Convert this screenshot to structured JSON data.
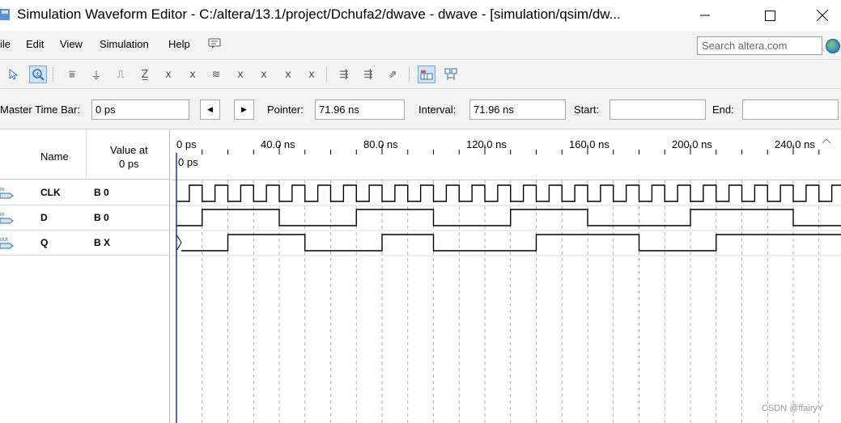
{
  "window": {
    "title": "Simulation Waveform Editor - C:/altera/13.1/project/Dchufa2/dwave - dwave - [simulation/qsim/dw...",
    "min_icon": "minimize-icon",
    "max_icon": "maximize-icon",
    "close_icon": "close-icon"
  },
  "menu": {
    "items": [
      "ile",
      "Edit",
      "View",
      "Simulation",
      "Help"
    ],
    "search_placeholder": "Search altera.com"
  },
  "toolbar": {
    "icons": [
      "pointer-icon",
      "zoom-icon",
      "overwrite-unknown-icon",
      "force-low-icon",
      "force-high-icon",
      "high-impedance-icon",
      "weak-low-icon",
      "weak-high-icon",
      "invert-icon",
      "count-value-icon",
      "clock-value-icon",
      "arbitrary-value-icon",
      "random-value-icon",
      "snap-icon",
      "run-functional-icon",
      "run-timing-icon",
      "grid-icon",
      "group-icon"
    ]
  },
  "timebar": {
    "master_label": "Master Time Bar:",
    "master_value": "0 ps",
    "prev_icon": "previous-transition-icon",
    "next_icon": "next-transition-icon",
    "pointer_label": "Pointer:",
    "pointer_value": "71.96 ns",
    "interval_label": "Interval:",
    "interval_value": "71.96 ns",
    "start_label": "Start:",
    "start_value": "",
    "end_label": "End:",
    "end_value": ""
  },
  "signals": {
    "header_name": "Name",
    "header_value_line1": "Value at",
    "header_value_line2": "0 ps",
    "rows": [
      {
        "io": "in",
        "name": "CLK",
        "value": "B 0"
      },
      {
        "io": "in",
        "name": "D",
        "value": "B 0"
      },
      {
        "io": "out",
        "name": "Q",
        "value": "B X"
      }
    ]
  },
  "timeline": {
    "ticks": [
      "0 ps",
      "40.0 ns",
      "80.0 ns",
      "120.0 ns",
      "160.0 ns",
      "200.0 ns",
      "240.0 ns"
    ],
    "cursor_label": "0 ps",
    "unit_ns_per_tick": 40,
    "clk_period_ns": 10,
    "d_transitions_ns": [
      10,
      40,
      70,
      100,
      130,
      160,
      200,
      240
    ],
    "d_initial": 0,
    "q_transitions_ns": [
      20,
      50,
      80,
      100,
      140,
      180,
      210
    ],
    "q_initial": "X"
  },
  "watermark": "CSDN @ffairyY"
}
